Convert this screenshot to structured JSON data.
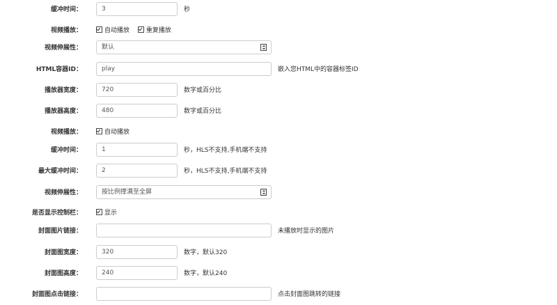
{
  "rows": [
    {
      "label": "缓冲时间：",
      "value": "3",
      "hint": "秒"
    },
    {
      "label": "视频播放：",
      "options": [
        "自动播放",
        "重复播放"
      ]
    },
    {
      "label": "视频伸展性：",
      "value": "默认"
    },
    {
      "label": "HTML容器ID：",
      "value": "play",
      "hint": "嵌入您HTML中的容器标签ID"
    },
    {
      "label": "播放器宽度：",
      "value": "720",
      "hint": "数字或百分比"
    },
    {
      "label": "播放器高度：",
      "value": "480",
      "hint": "数字或百分比"
    },
    {
      "label": "视频播放：",
      "options": [
        "自动播放"
      ]
    },
    {
      "label": "缓冲时间：",
      "value": "1",
      "hint": "秒，HLS不支持,手机端不支持"
    },
    {
      "label": "最大缓冲时间：",
      "value": "2",
      "hint": "秒，HLS不支持,手机端不支持"
    },
    {
      "label": "视频伸展性：",
      "value": "按比例撑满至全屏"
    },
    {
      "label": "是否显示控制栏：",
      "options": [
        "显示"
      ]
    },
    {
      "label": "封面图片链接：",
      "value": "",
      "hint": "未播放时显示的图片"
    },
    {
      "label": "封面图宽度：",
      "value": "320",
      "hint": "数字，默认320"
    },
    {
      "label": "封面图高度：",
      "value": "240",
      "hint": "数字，默认240"
    },
    {
      "label": "封面图点击链接：",
      "value": "",
      "hint": "点击封面图跳转的链接"
    }
  ]
}
